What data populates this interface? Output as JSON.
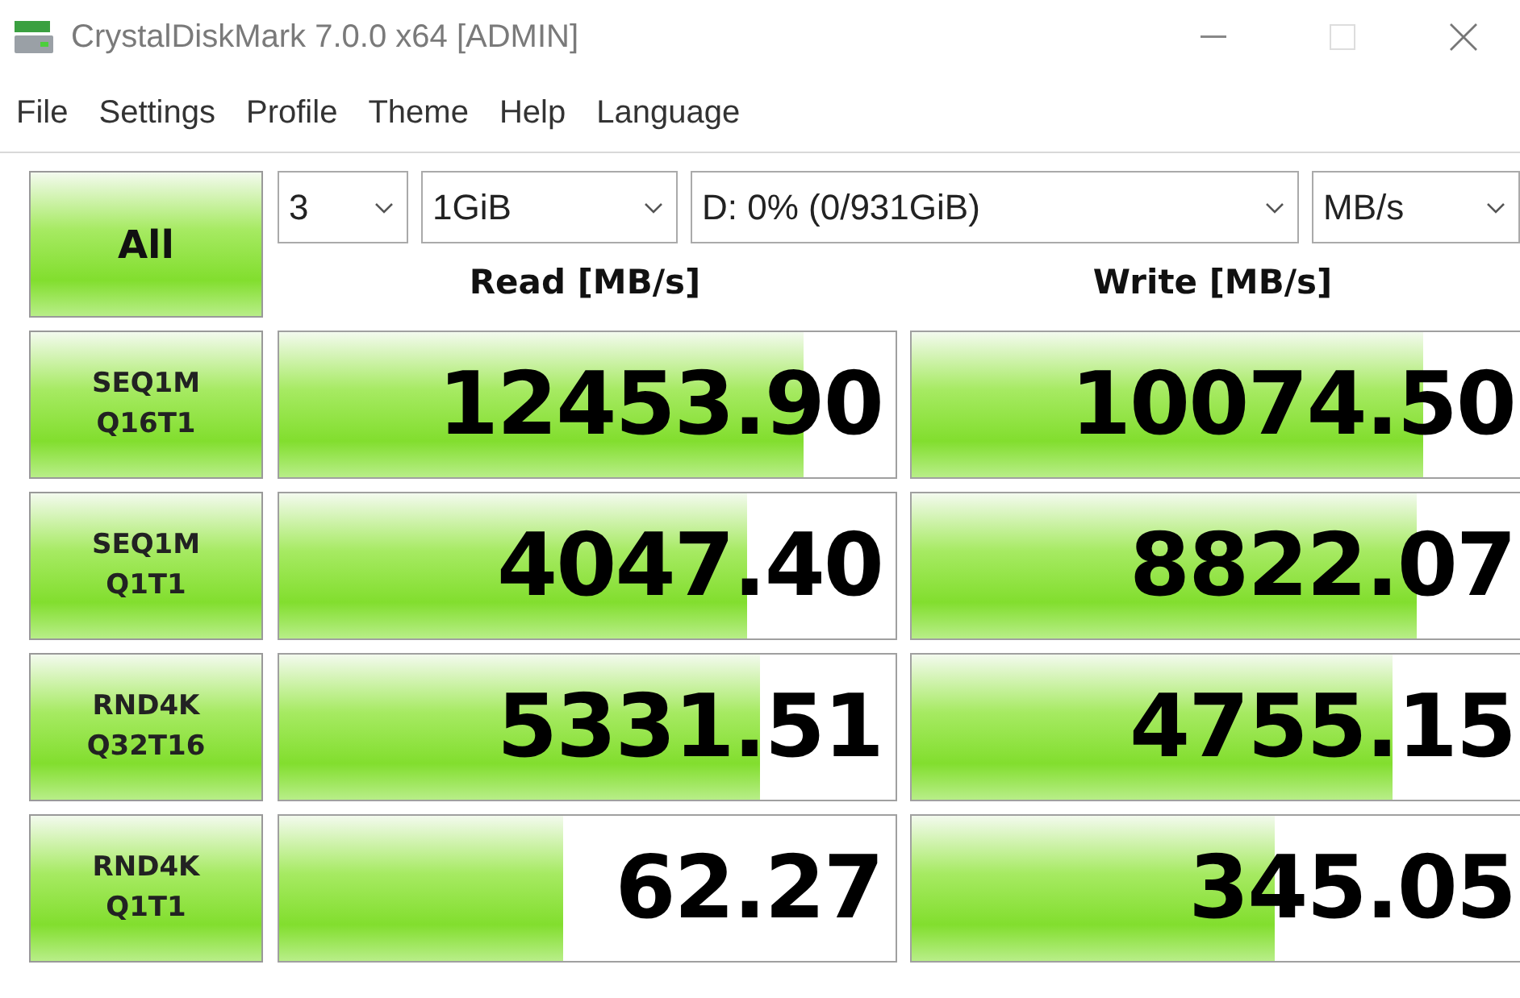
{
  "window": {
    "title": "CrystalDiskMark 7.0.0 x64 [ADMIN]"
  },
  "menu": [
    "File",
    "Settings",
    "Profile",
    "Theme",
    "Help",
    "Language"
  ],
  "all_button": "All",
  "selects": [
    {
      "value": "3"
    },
    {
      "value": "1GiB"
    },
    {
      "value": "D: 0% (0/931GiB)"
    },
    {
      "value": "MB/s"
    }
  ],
  "columns": [
    "Read [MB/s]",
    "Write [MB/s]"
  ],
  "tests": [
    {
      "line1": "SEQ1M",
      "line2": "Q16T1",
      "read": {
        "value": "12453.90",
        "level": 0.85
      },
      "write": {
        "value": "10074.50",
        "level": 0.83
      }
    },
    {
      "line1": "SEQ1M",
      "line2": "Q1T1",
      "read": {
        "value": "4047.40",
        "level": 0.76
      },
      "write": {
        "value": "8822.07",
        "level": 0.82
      }
    },
    {
      "line1": "RND4K",
      "line2": "Q32T16",
      "read": {
        "value": "5331.51",
        "level": 0.78
      },
      "write": {
        "value": "4755.15",
        "level": 0.78
      }
    },
    {
      "line1": "RND4K",
      "line2": "Q1T1",
      "read": {
        "value": "62.27",
        "level": 0.46
      },
      "write": {
        "value": "345.05",
        "level": 0.59
      }
    }
  ]
}
